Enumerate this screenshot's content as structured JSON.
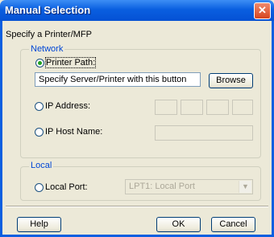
{
  "window": {
    "title": "Manual Selection",
    "close_glyph": "✕"
  },
  "caption": "Specify a Printer/MFP",
  "network": {
    "legend": "Network",
    "printer_path": {
      "label": "Printer Path:",
      "selected": true,
      "value": "Specify Server/Printer with this button",
      "browse_label": "Browse"
    },
    "ip_address": {
      "label": "IP Address:",
      "selected": false
    },
    "ip_host_name": {
      "label": "IP Host Name:",
      "selected": false
    }
  },
  "local": {
    "legend": "Local",
    "local_port": {
      "label": "Local Port:",
      "selected": false,
      "value": "LPT1: Local Port"
    }
  },
  "buttons": {
    "help": "Help",
    "ok": "OK",
    "cancel": "Cancel"
  },
  "colors": {
    "title_bar": "#0a5fe0",
    "legend_text": "#0046d5",
    "dialog_bg": "#ece9d8"
  }
}
